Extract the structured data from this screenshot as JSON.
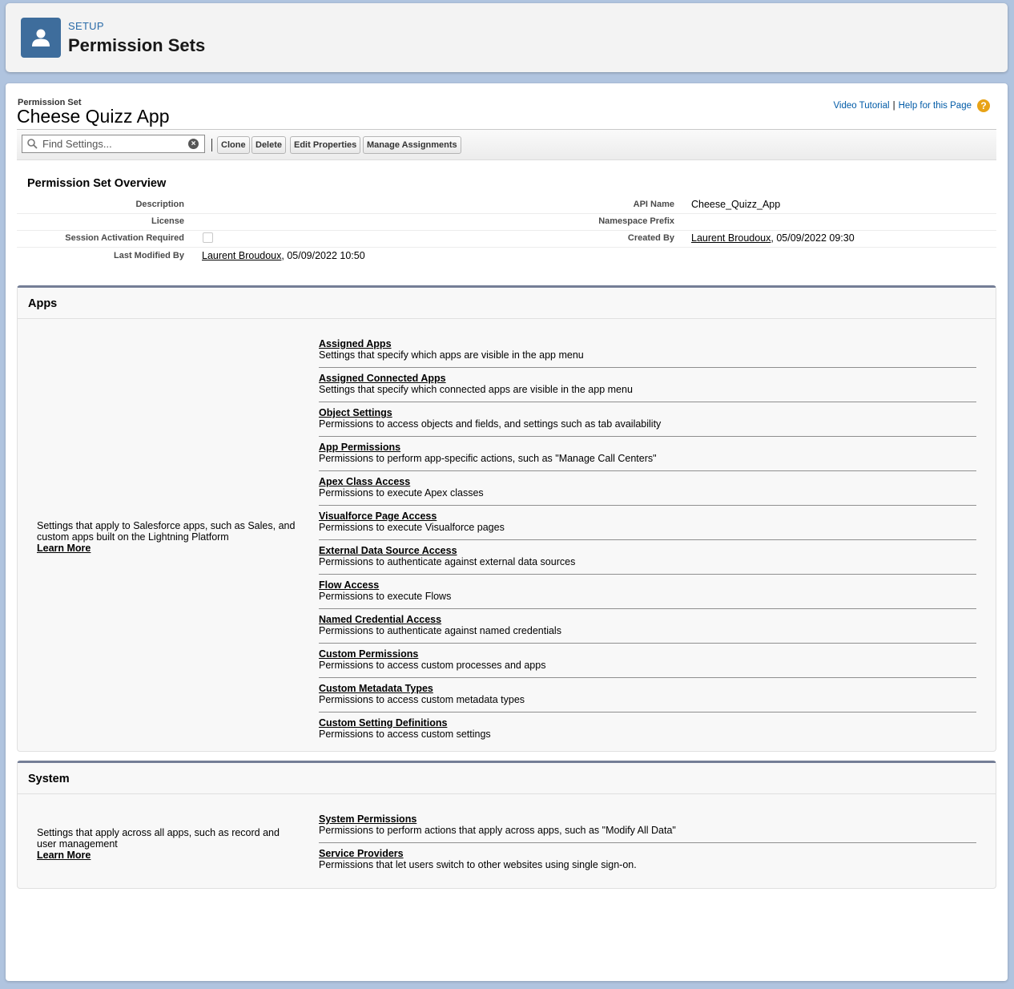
{
  "header": {
    "eyebrow": "SETUP",
    "title": "Permission Sets",
    "icon": "user-icon"
  },
  "record": {
    "type_label": "Permission Set",
    "name": "Cheese Quizz App"
  },
  "help": {
    "video_tutorial": "Video Tutorial",
    "separator": "|",
    "help_for_page": "Help for this Page",
    "help_icon": "?"
  },
  "toolbar": {
    "search_placeholder": "Find Settings...",
    "clone": "Clone",
    "delete": "Delete",
    "edit_properties": "Edit Properties",
    "manage_assignments": "Manage Assignments"
  },
  "overview": {
    "title": "Permission Set Overview",
    "description_label": "Description",
    "description_value": "",
    "license_label": "License",
    "license_value": "",
    "session_label": "Session Activation Required",
    "session_checked": false,
    "last_modified_label": "Last Modified By",
    "last_modified_user": "Laurent Broudoux",
    "last_modified_date": ", 05/09/2022 10:50",
    "api_name_label": "API Name",
    "api_name_value": "Cheese_Quizz_App",
    "namespace_label": "Namespace Prefix",
    "namespace_value": "",
    "created_by_label": "Created By",
    "created_by_user": "Laurent Broudoux",
    "created_by_date": ", 05/09/2022 09:30"
  },
  "apps": {
    "title": "Apps",
    "description": "Settings that apply to Salesforce apps, such as Sales, and custom apps built on the Lightning Platform",
    "learn_more": "Learn More",
    "items": [
      {
        "label": "Assigned Apps",
        "desc": "Settings that specify which apps are visible in the app menu"
      },
      {
        "label": "Assigned Connected Apps",
        "desc": "Settings that specify which connected apps are visible in the app menu"
      },
      {
        "label": "Object Settings",
        "desc": "Permissions to access objects and fields, and settings such as tab availability"
      },
      {
        "label": "App Permissions",
        "desc": "Permissions to perform app-specific actions, such as \"Manage Call Centers\""
      },
      {
        "label": "Apex Class Access",
        "desc": "Permissions to execute Apex classes"
      },
      {
        "label": "Visualforce Page Access",
        "desc": "Permissions to execute Visualforce pages"
      },
      {
        "label": "External Data Source Access",
        "desc": "Permissions to authenticate against external data sources"
      },
      {
        "label": "Flow Access",
        "desc": "Permissions to execute Flows"
      },
      {
        "label": "Named Credential Access",
        "desc": "Permissions to authenticate against named credentials"
      },
      {
        "label": "Custom Permissions",
        "desc": "Permissions to access custom processes and apps"
      },
      {
        "label": "Custom Metadata Types",
        "desc": "Permissions to access custom metadata types"
      },
      {
        "label": "Custom Setting Definitions",
        "desc": "Permissions to access custom settings"
      }
    ]
  },
  "system": {
    "title": "System",
    "description": "Settings that apply across all apps, such as record and user management",
    "learn_more": "Learn More",
    "items": [
      {
        "label": "System Permissions",
        "desc": "Permissions to perform actions that apply across apps, such as \"Modify All Data\""
      },
      {
        "label": "Service Providers",
        "desc": "Permissions that let users switch to other websites using single sign-on."
      }
    ]
  }
}
